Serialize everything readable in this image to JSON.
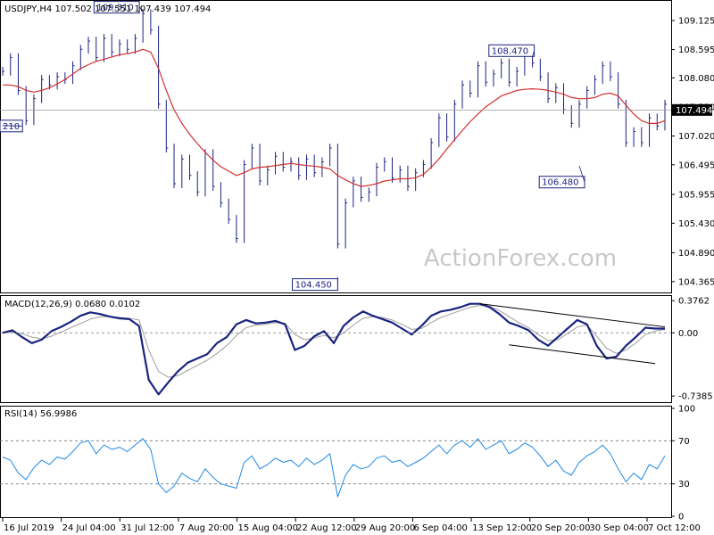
{
  "chart_data": [
    {
      "type": "line",
      "panel": "price",
      "subtitle": "USDJPY,H4  107.502 107.551 107.439 107.494",
      "title_symbol": "USDJPY,H4",
      "ohlc": [
        "107.502",
        "107.551",
        "107.439",
        "107.494"
      ],
      "ylim": [
        104.2,
        109.45
      ],
      "y_ticks": [
        "109.125",
        "108.595",
        "108.080",
        "107.550",
        "107.020",
        "106.495",
        "105.955",
        "105.430",
        "104.890",
        "104.365"
      ],
      "y_tick_values": [
        109.125,
        108.595,
        108.08,
        107.55,
        107.02,
        106.495,
        105.955,
        105.43,
        104.89,
        104.365
      ],
      "current_price_label": "107.494",
      "current_price": 107.494,
      "annotations": [
        {
          "text": "109.310",
          "x": "1 Aug 2019",
          "y": 109.31
        },
        {
          "text": "104.450",
          "x": "26 Aug 2019",
          "y": 104.45
        },
        {
          "text": "108.470",
          "x": "4 Oct 2019",
          "y": 108.47
        },
        {
          "text": "106.480",
          "x": "7 Oct 2019",
          "y": 106.48
        },
        {
          "text": "210",
          "x": "16 Jul 2019",
          "y": 107.21
        }
      ],
      "watermark": "ActionForex.com",
      "series": [
        {
          "name": "",
          "role": "price",
          "color": "#1a237e",
          "values": [
            108.2,
            108.45,
            107.85,
            107.3,
            107.7,
            108.05,
            107.95,
            108.1,
            108.05,
            108.3,
            108.6,
            108.75,
            108.45,
            108.8,
            108.55,
            108.7,
            108.6,
            108.8,
            109.25,
            108.95,
            107.6,
            106.8,
            106.15,
            106.6,
            106.3,
            106.0,
            106.7,
            106.1,
            105.8,
            105.5,
            105.15,
            106.5,
            106.8,
            106.2,
            106.4,
            106.65,
            106.45,
            106.55,
            106.3,
            106.6,
            106.35,
            106.55,
            106.8,
            105.05,
            105.8,
            106.2,
            105.9,
            106.0,
            106.45,
            106.55,
            106.25,
            106.4,
            106.1,
            106.35,
            106.5,
            106.9,
            107.35,
            107.0,
            107.6,
            107.95,
            107.8,
            108.3,
            108.0,
            108.15,
            108.35,
            108.0,
            108.2,
            108.5,
            108.35,
            108.1,
            107.7,
            107.9,
            107.5,
            107.25,
            107.6,
            107.85,
            108.05,
            108.3,
            108.1,
            107.6,
            106.9,
            107.1,
            106.9,
            107.35,
            107.2,
            107.6
          ]
        },
        {
          "name": "",
          "role": "moving-average",
          "color": "#d32f2f",
          "values": [
            107.95,
            107.95,
            107.92,
            107.85,
            107.82,
            107.85,
            107.9,
            107.97,
            108.05,
            108.15,
            108.25,
            108.32,
            108.38,
            108.42,
            108.46,
            108.5,
            108.52,
            108.55,
            108.6,
            108.55,
            108.25,
            107.85,
            107.5,
            107.25,
            107.05,
            106.88,
            106.72,
            106.58,
            106.46,
            106.38,
            106.3,
            106.35,
            106.42,
            106.45,
            106.46,
            106.48,
            106.5,
            106.52,
            106.5,
            106.48,
            106.47,
            106.45,
            106.42,
            106.3,
            106.22,
            106.15,
            106.1,
            106.12,
            106.15,
            106.2,
            106.22,
            106.24,
            106.24,
            106.26,
            106.32,
            106.45,
            106.6,
            106.78,
            106.95,
            107.12,
            107.28,
            107.42,
            107.55,
            107.65,
            107.75,
            107.8,
            107.85,
            107.87,
            107.88,
            107.87,
            107.85,
            107.82,
            107.78,
            107.72,
            107.7,
            107.7,
            107.72,
            107.78,
            107.8,
            107.75,
            107.58,
            107.42,
            107.3,
            107.25,
            107.25,
            107.3
          ]
        }
      ]
    },
    {
      "type": "line",
      "panel": "macd",
      "subtitle": "MACD(12,26,9) 0.0680 0.0102",
      "ylim": [
        -0.8,
        0.42
      ],
      "y_ticks": [
        "0.3762",
        "0.00",
        "-0.7385"
      ],
      "y_tick_values": [
        0.3762,
        0.0,
        -0.7385
      ],
      "trendlines": [
        {
          "from": [
            "13 Sep 2019",
            0.34
          ],
          "to": [
            "9 Oct 2019",
            0.07
          ]
        },
        {
          "from": [
            "17 Sep 2019",
            -0.14
          ],
          "to": [
            "8 Oct 2019",
            -0.36
          ]
        }
      ],
      "series": [
        {
          "name": "",
          "role": "macd",
          "color": "#1a237e",
          "values": [
            0.0,
            0.03,
            -0.05,
            -0.12,
            -0.08,
            0.02,
            0.07,
            0.13,
            0.2,
            0.24,
            0.22,
            0.19,
            0.17,
            0.16,
            0.08,
            -0.55,
            -0.72,
            -0.58,
            -0.45,
            -0.35,
            -0.3,
            -0.25,
            -0.12,
            -0.05,
            0.1,
            0.15,
            0.11,
            0.12,
            0.14,
            0.1,
            -0.2,
            -0.15,
            -0.04,
            0.02,
            -0.12,
            0.08,
            0.18,
            0.25,
            0.2,
            0.16,
            0.12,
            0.05,
            -0.02,
            0.08,
            0.2,
            0.25,
            0.27,
            0.3,
            0.34,
            0.34,
            0.3,
            0.22,
            0.12,
            0.08,
            0.03,
            -0.08,
            -0.15,
            -0.05,
            0.05,
            0.15,
            0.1,
            -0.15,
            -0.3,
            -0.28,
            -0.15,
            -0.05,
            0.06,
            0.05,
            0.05
          ]
        },
        {
          "name": "",
          "role": "signal",
          "color": "#9e9e9e",
          "values": [
            0.0,
            0.01,
            -0.01,
            -0.05,
            -0.07,
            -0.04,
            0.01,
            0.06,
            0.11,
            0.16,
            0.19,
            0.19,
            0.18,
            0.17,
            0.15,
            -0.2,
            -0.45,
            -0.52,
            -0.5,
            -0.44,
            -0.38,
            -0.32,
            -0.24,
            -0.15,
            -0.03,
            0.06,
            0.09,
            0.1,
            0.12,
            0.11,
            -0.02,
            -0.08,
            -0.06,
            -0.03,
            -0.06,
            0.0,
            0.09,
            0.17,
            0.19,
            0.18,
            0.15,
            0.1,
            0.04,
            0.05,
            0.12,
            0.18,
            0.22,
            0.26,
            0.3,
            0.32,
            0.31,
            0.26,
            0.19,
            0.12,
            0.06,
            -0.02,
            -0.09,
            -0.08,
            -0.01,
            0.07,
            0.09,
            -0.04,
            -0.18,
            -0.24,
            -0.2,
            -0.12,
            -0.02,
            0.02,
            0.04
          ]
        }
      ]
    },
    {
      "type": "line",
      "panel": "rsi",
      "subtitle": "RSI(14) 56.9986",
      "ylim": [
        0,
        100
      ],
      "y_ticks": [
        "100",
        "70",
        "30",
        "0"
      ],
      "y_tick_values": [
        100,
        70,
        30,
        0
      ],
      "reference_levels": [
        70,
        30
      ],
      "series": [
        {
          "name": "",
          "role": "rsi",
          "color": "#1e88e5",
          "values": [
            55,
            52,
            40,
            34,
            45,
            52,
            48,
            55,
            53,
            60,
            68,
            70,
            58,
            66,
            62,
            64,
            60,
            66,
            72,
            62,
            30,
            22,
            28,
            40,
            35,
            32,
            44,
            36,
            30,
            28,
            26,
            50,
            56,
            44,
            48,
            54,
            50,
            52,
            46,
            54,
            48,
            52,
            58,
            18,
            38,
            48,
            44,
            46,
            54,
            56,
            50,
            52,
            46,
            50,
            54,
            60,
            66,
            58,
            66,
            70,
            64,
            72,
            62,
            66,
            70,
            58,
            62,
            68,
            64,
            56,
            46,
            52,
            42,
            38,
            50,
            56,
            60,
            66,
            58,
            44,
            32,
            40,
            34,
            48,
            44,
            56
          ]
        }
      ]
    }
  ],
  "x_axis": {
    "labels": [
      "16 Jul 2019",
      "24 Jul 04:00",
      "31 Jul 12:00",
      "7 Aug 20:00",
      "15 Aug 04:00",
      "22 Aug 12:00",
      "29 Aug 20:00",
      "6 Sep 04:00",
      "13 Sep 12:00",
      "20 Sep 20:00",
      "30 Sep 04:00",
      "7 Oct 12:00"
    ]
  },
  "colors": {
    "price": "#1a237e",
    "moving_average": "#d32f2f",
    "rsi": "#1e88e5",
    "signal": "#9e9e9e",
    "grid": "#000000",
    "watermark": "#c8c8c8"
  }
}
